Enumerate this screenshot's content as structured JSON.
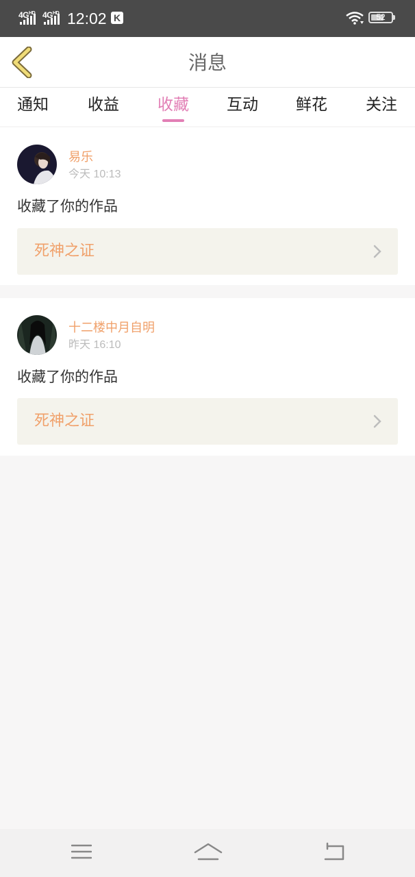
{
  "status_bar": {
    "signal_1": "4G",
    "signal_2": "4G",
    "hd": "HD",
    "time": "12:02",
    "k_badge": "K",
    "battery": "52"
  },
  "header": {
    "title": "消息"
  },
  "tabs": [
    {
      "label": "通知"
    },
    {
      "label": "收益"
    },
    {
      "label": "收藏",
      "active": true
    },
    {
      "label": "互动"
    },
    {
      "label": "鲜花"
    },
    {
      "label": "关注"
    }
  ],
  "messages": [
    {
      "user": "易乐",
      "time": "今天 10:13",
      "action": "收藏了你的作品",
      "work_title": "死神之证"
    },
    {
      "user": "十二楼中月自明",
      "time": "昨天 16:10",
      "action": "收藏了你的作品",
      "work_title": "死神之证"
    }
  ],
  "colors": {
    "accent": "#e27fb5",
    "username": "#f0a06a",
    "status_bar": "#4a4a4a",
    "work_bg": "#f4f3ec"
  },
  "icons": {
    "back": "back-arrow-icon",
    "chevron": "chevron-right-icon",
    "nav_menu": "menu-icon",
    "nav_home": "home-icon",
    "nav_back": "back-icon"
  }
}
